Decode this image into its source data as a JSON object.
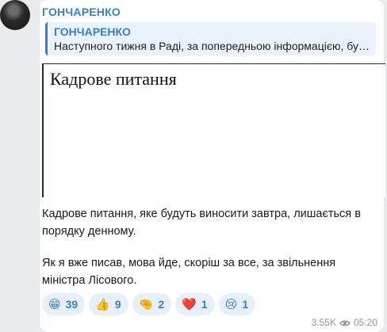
{
  "sender": "ГОНЧАРЕНКО",
  "reply": {
    "name": "ГОНЧАРЕНКО",
    "text": "Наступного тижня в Раді, за попередньою інформацією, бу…"
  },
  "document": {
    "title": "Кадрове питання"
  },
  "message": {
    "paragraph1": "Кадрове питання, яке будуть виносити завтра, лишається в порядку денному.",
    "paragraph2": "Як я вже писав, мова йде, скоріш за все, за звільнення міністра Лісового."
  },
  "reactions": [
    {
      "emoji": "😁",
      "count": "39"
    },
    {
      "emoji": "👍",
      "count": "9"
    },
    {
      "emoji": "🤏",
      "count": "2"
    },
    {
      "emoji": "❤️",
      "count": "1"
    },
    {
      "emoji": "😢",
      "count": "1"
    }
  ],
  "footer": {
    "views": "3.55K",
    "time": "05:20"
  },
  "colors": {
    "accent": "#3a7fc4",
    "reaction_bg": "#e7f0f9",
    "background": "#e9ecef"
  },
  "icons": {
    "views": "eye-icon"
  }
}
